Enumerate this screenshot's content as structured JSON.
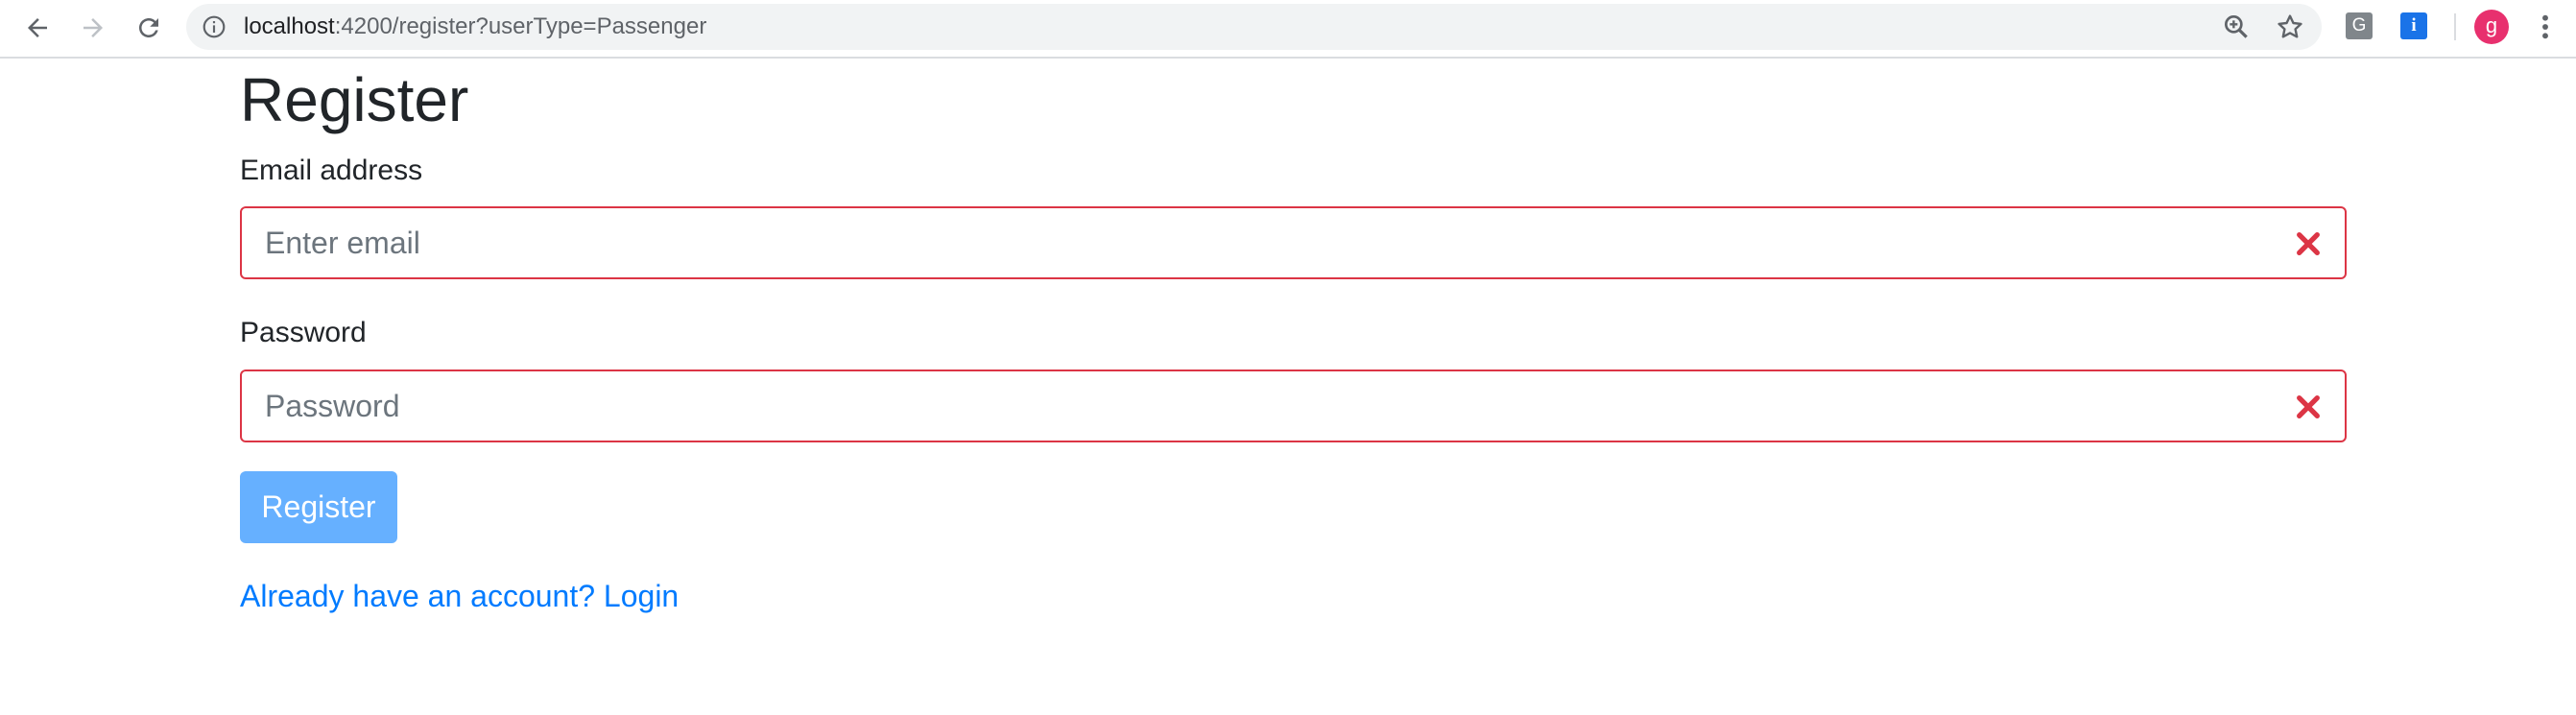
{
  "browser": {
    "url_host": "localhost",
    "url_rest": ":4200/register?userType=Passenger",
    "extensions": [
      {
        "name": "g-extension-icon",
        "label": "G",
        "color": "#80868b"
      },
      {
        "name": "info-extension-icon",
        "label": "i",
        "color": "#1a73e8"
      }
    ],
    "profile_initial": "g",
    "profile_color": "#e8306e"
  },
  "page": {
    "title": "Register",
    "email": {
      "label": "Email address",
      "placeholder": "Enter email",
      "value": ""
    },
    "password": {
      "label": "Password",
      "placeholder": "Password",
      "value": ""
    },
    "submit_label": "Register",
    "login_link": "Already have an account? Login"
  },
  "colors": {
    "invalid": "#dc3545",
    "button": "#66b0ff",
    "link": "#007bff"
  }
}
